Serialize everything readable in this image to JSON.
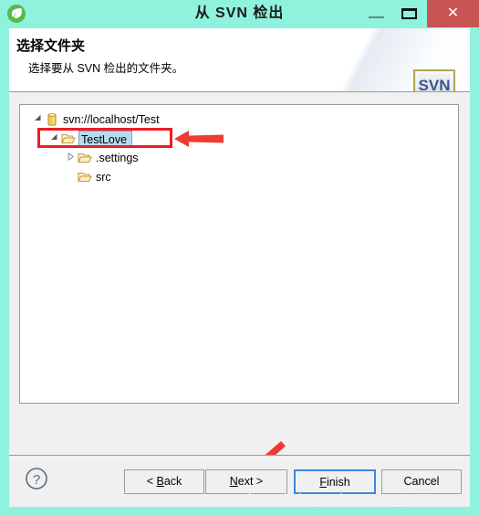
{
  "window": {
    "title": "从 SVN 检出",
    "app_icon": "leaf-icon",
    "controls": {
      "minimize": "—",
      "maximize": "❐",
      "close": "✕",
      "close_color": "#c85454"
    },
    "titlebar_color": "#8ff2dc"
  },
  "header": {
    "title": "选择文件夹",
    "description": "选择要从 SVN 检出的文件夹。",
    "logo_text": "SVN"
  },
  "tree": {
    "nodes": [
      {
        "label": "svn://localhost/Test",
        "icon": "repository-icon",
        "expander": "▲",
        "expanded": true,
        "selected": false,
        "indent": 0
      },
      {
        "label": "TestLove",
        "icon": "open-folder-icon",
        "expander": "▲",
        "expanded": true,
        "selected": true,
        "indent": 1
      },
      {
        "label": ".settings",
        "icon": "open-folder-icon",
        "expander": "▷",
        "expanded": false,
        "selected": false,
        "indent": 2
      },
      {
        "label": "src",
        "icon": "open-folder-icon",
        "expander": "",
        "expanded": false,
        "selected": false,
        "indent": 2
      }
    ],
    "selection_bg": "#b5dcf2"
  },
  "annotations": {
    "highlight_color": "#ee1c25",
    "arrow_tree": "left-arrow-to-testlove",
    "arrow_next": "down-left-arrow-to-next-button"
  },
  "footer": {
    "help_label": "?",
    "buttons": [
      {
        "label_pre": "< ",
        "mnemonic": "B",
        "label_post": "ack",
        "name": "back"
      },
      {
        "label_pre": "",
        "mnemonic": "N",
        "label_post": "ext >",
        "name": "next"
      },
      {
        "label_pre": "",
        "mnemonic": "F",
        "label_post": "inish",
        "name": "finish"
      },
      {
        "label_pre": "",
        "mnemonic": "",
        "label_post": "Cancel",
        "name": "cancel"
      }
    ],
    "focus_color": "#3d88d8"
  },
  "watermark": {
    "text": "https://blog.csdn.net/qq_24552437"
  }
}
